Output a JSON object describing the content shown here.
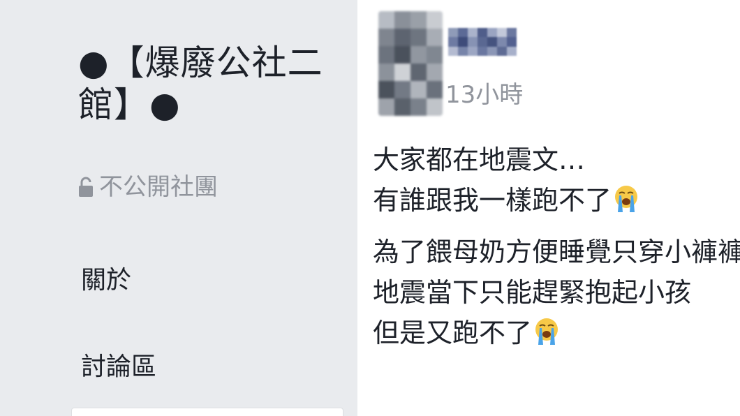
{
  "sidebar": {
    "group_name": "●【爆廢公社二館】●",
    "privacy_label": "不公開社團",
    "privacy_icon": "lock-icon",
    "nav_items": [
      {
        "label": "關於"
      },
      {
        "label": "討論區"
      }
    ]
  },
  "post": {
    "timestamp": "13小時",
    "lines": [
      "大家都在地震文…",
      "有誰跟我一樣跑不了",
      "為了餵母奶方便睡覺只穿小褲褲",
      "地震當下只能趕緊抱起小孩",
      "但是又跑不了"
    ],
    "emoji": "loudly-crying-face"
  },
  "colors": {
    "sidebar_bg": "#e9ebee",
    "primary_text": "#1d2129",
    "secondary_text": "#90949c",
    "emoji_yellow": "#f7c948",
    "emoji_tears": "#4aa3e8"
  }
}
